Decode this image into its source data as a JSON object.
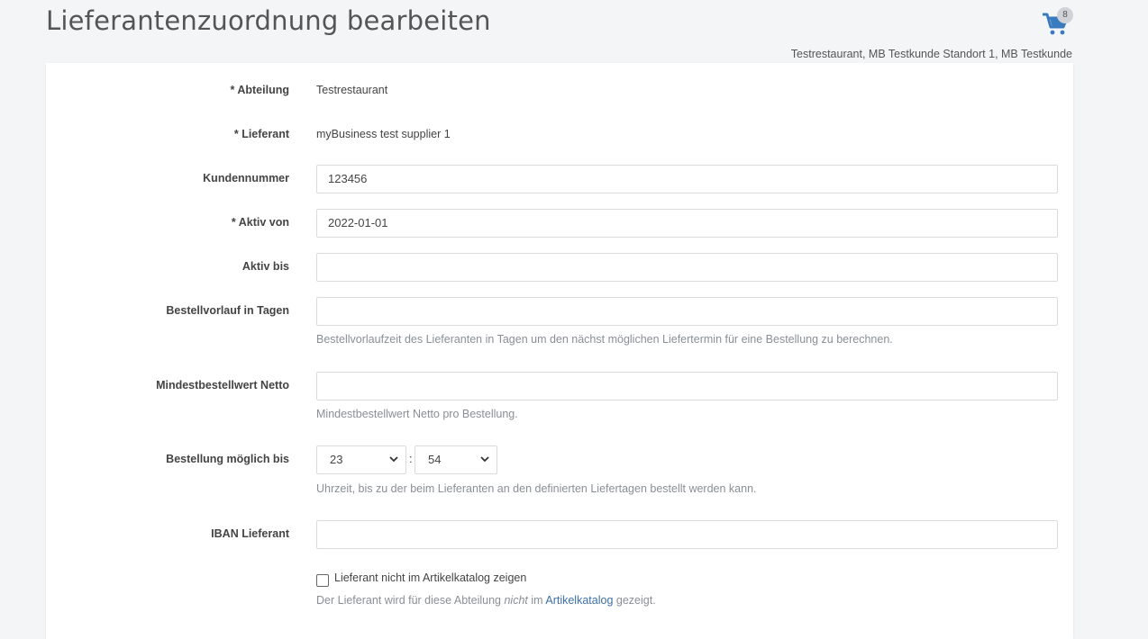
{
  "header": {
    "title": "Lieferantenzuordnung bearbeiten",
    "cart_count": "8",
    "context": "Testrestaurant, MB Testkunde Standort 1, MB Testkunde"
  },
  "form": {
    "abteilung": {
      "label": "* Abteilung",
      "value": "Testrestaurant"
    },
    "lieferant": {
      "label": "* Lieferant",
      "value": "myBusiness test supplier 1"
    },
    "kundennummer": {
      "label": "Kundennummer",
      "value": "123456"
    },
    "aktiv_von": {
      "label": "* Aktiv von",
      "value": "2022-01-01"
    },
    "aktiv_bis": {
      "label": "Aktiv bis",
      "value": ""
    },
    "bestellvorlauf": {
      "label": "Bestellvorlauf in Tagen",
      "value": "",
      "help": "Bestellvorlaufzeit des Lieferanten in Tagen um den nächst möglichen Liefertermin für eine Bestellung zu berechnen."
    },
    "mindestbestellwert": {
      "label": "Mindestbestellwert Netto",
      "value": "",
      "help": "Mindestbestellwert Netto pro Bestellung."
    },
    "bestellung_bis": {
      "label": "Bestellung möglich bis",
      "hour": "23",
      "separator": ":",
      "minute": "54",
      "help": "Uhrzeit, bis zu der beim Lieferanten an den definierten Liefertagen bestellt werden kann."
    },
    "iban": {
      "label": "IBAN Lieferant",
      "value": ""
    },
    "katalog": {
      "checkbox_label": "Lieferant nicht im Artikelkatalog zeigen",
      "checked": false,
      "help_prefix": "Der Lieferant wird für diese Abteilung",
      "help_emphasis": "nicht",
      "help_middle": "im",
      "help_link": "Artikelkatalog",
      "help_suffix": "gezeigt."
    }
  },
  "colors": {
    "accent": "#3a7bbf",
    "link": "#3a6fa8"
  }
}
